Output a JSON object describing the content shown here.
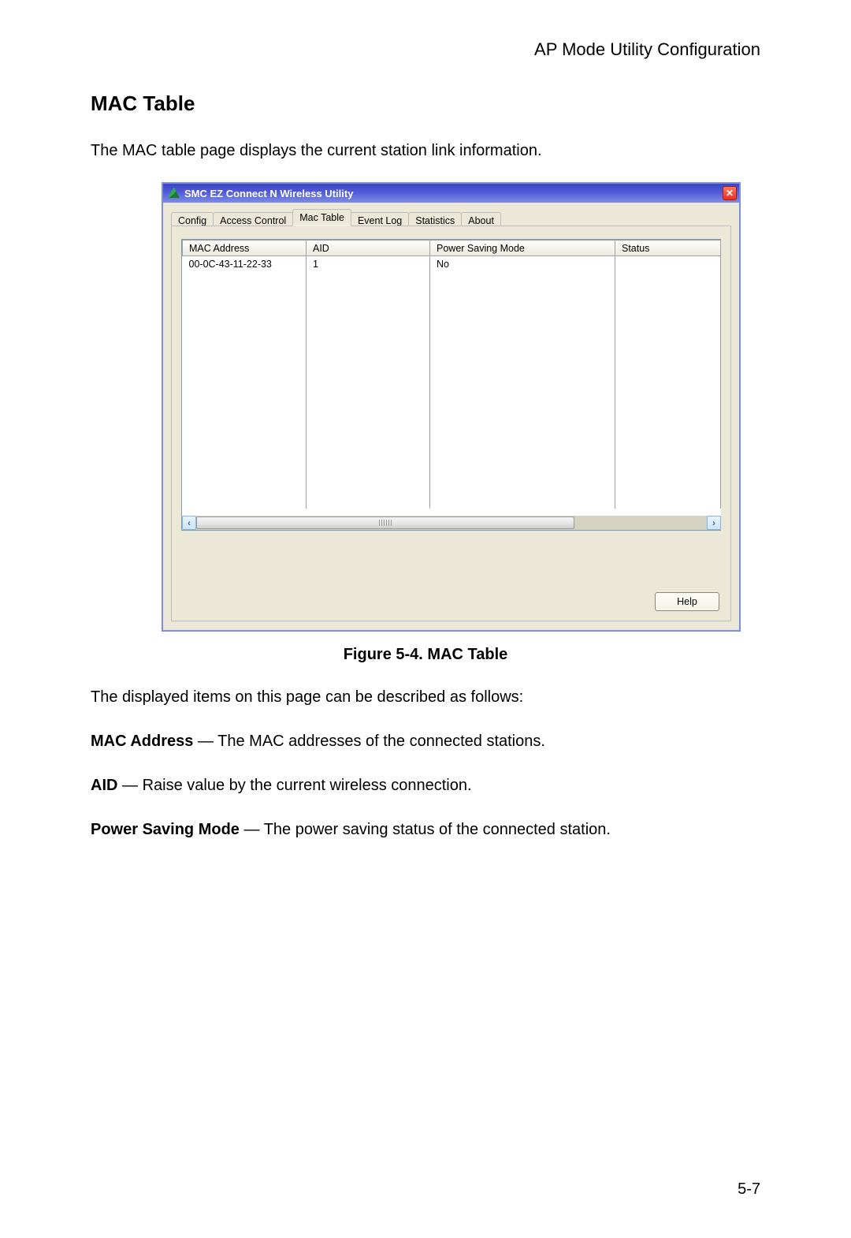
{
  "doc": {
    "header": "AP Mode Utility Configuration",
    "h2": "MAC Table",
    "intro": "The MAC table page displays the current station link information.",
    "figure_caption": "Figure 5-4.  MAC Table",
    "desc_intro": "The displayed items on this page can be described as follows:",
    "mac_addr_label": "MAC Address",
    "mac_addr_text": " — The MAC addresses of the connected stations.",
    "aid_label": "AID",
    "aid_text": " — Raise value by the current wireless connection.",
    "psm_label": "Power Saving Mode",
    "psm_text": " — The power saving status of the connected station.",
    "page_number": "5-7"
  },
  "window": {
    "title": "SMC EZ Connect N Wireless Utility",
    "close_glyph": "✕",
    "tabs": {
      "config": "Config",
      "access_control": "Access Control",
      "mac_table": "Mac Table",
      "event_log": "Event Log",
      "statistics": "Statistics",
      "about": "About"
    },
    "columns": {
      "mac": "MAC Address",
      "aid": "AID",
      "psm": "Power Saving Mode",
      "status": "Status"
    },
    "rows": [
      {
        "mac": "00-0C-43-11-22-33",
        "aid": "1",
        "psm": "No",
        "status": ""
      }
    ],
    "scroll": {
      "left_glyph": "‹",
      "right_glyph": "›"
    },
    "help": "Help"
  }
}
